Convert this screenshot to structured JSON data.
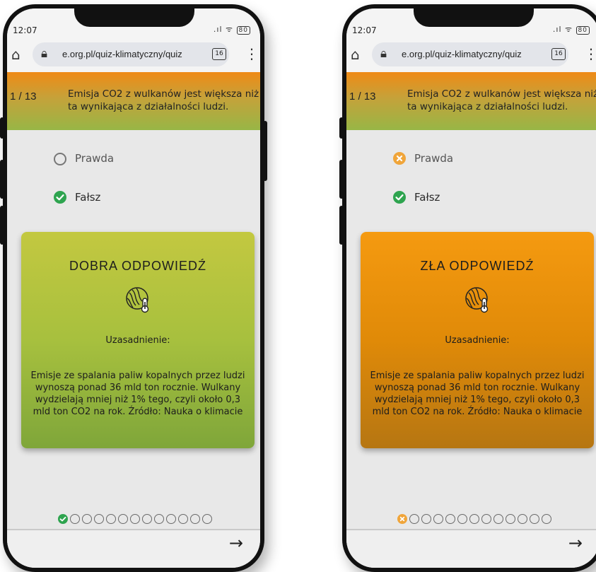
{
  "screens": [
    {
      "status": {
        "time": "12:07",
        "signal": ".ıl",
        "wifi": "ᯤ",
        "battery": "80"
      },
      "browser": {
        "url": "e.org.pl/quiz-klimatyczny/quiz",
        "tab_count": "16"
      },
      "question": {
        "counter": "1 / 13",
        "text": "Emisja CO2 z wulkanów jest większa niż ta wynikająca z działalności ludzi."
      },
      "answers": [
        {
          "label": "Prawda",
          "state": "unselected"
        },
        {
          "label": "Fałsz",
          "state": "correct"
        }
      ],
      "result": {
        "title": "DOBRA ODPOWIEDŹ",
        "reason_label": "Uzasadnienie:",
        "reason_text": "Emisje ze spalania paliw kopalnych przez ludzi wynoszą ponad 36 mld ton rocznie. Wulkany wydzielają mniej niż 1% tego, czyli około 0,3 mld ton CO2 na rok. Źródło: Nauka o klimacie",
        "color": "#a7c03e"
      },
      "progress": {
        "total": 13,
        "answered": 1,
        "first_state": "correct"
      },
      "next_icon": "arrow-right-icon"
    },
    {
      "status": {
        "time": "12:07",
        "signal": ".ıl",
        "wifi": "ᯤ",
        "battery": "80"
      },
      "browser": {
        "url": "e.org.pl/quiz-klimatyczny/quiz",
        "tab_count": "16"
      },
      "question": {
        "counter": "1 / 13",
        "text": "Emisja CO2 z wulkanów jest większa niż ta wynikająca z działalności ludzi."
      },
      "answers": [
        {
          "label": "Prawda",
          "state": "wrong"
        },
        {
          "label": "Fałsz",
          "state": "correct"
        }
      ],
      "result": {
        "title": "ZŁA ODPOWIEDŹ",
        "reason_label": "Uzasadnienie:",
        "reason_text": "Emisje ze spalania paliw kopalnych przez ludzi wynoszą ponad 36 mld ton rocznie. Wulkany wydzielają mniej niż 1% tego, czyli około 0,3 mld ton CO2 na rok. Źródło: Nauka o klimacie",
        "color": "#e08a08"
      },
      "progress": {
        "total": 13,
        "answered": 1,
        "first_state": "wrong"
      },
      "next_icon": "arrow-right-icon"
    }
  ],
  "colors": {
    "check_green": "#2ea44f",
    "wrong_orange": "#f0a53a",
    "header_orange": "#ef8a16",
    "header_green": "#98b646"
  }
}
